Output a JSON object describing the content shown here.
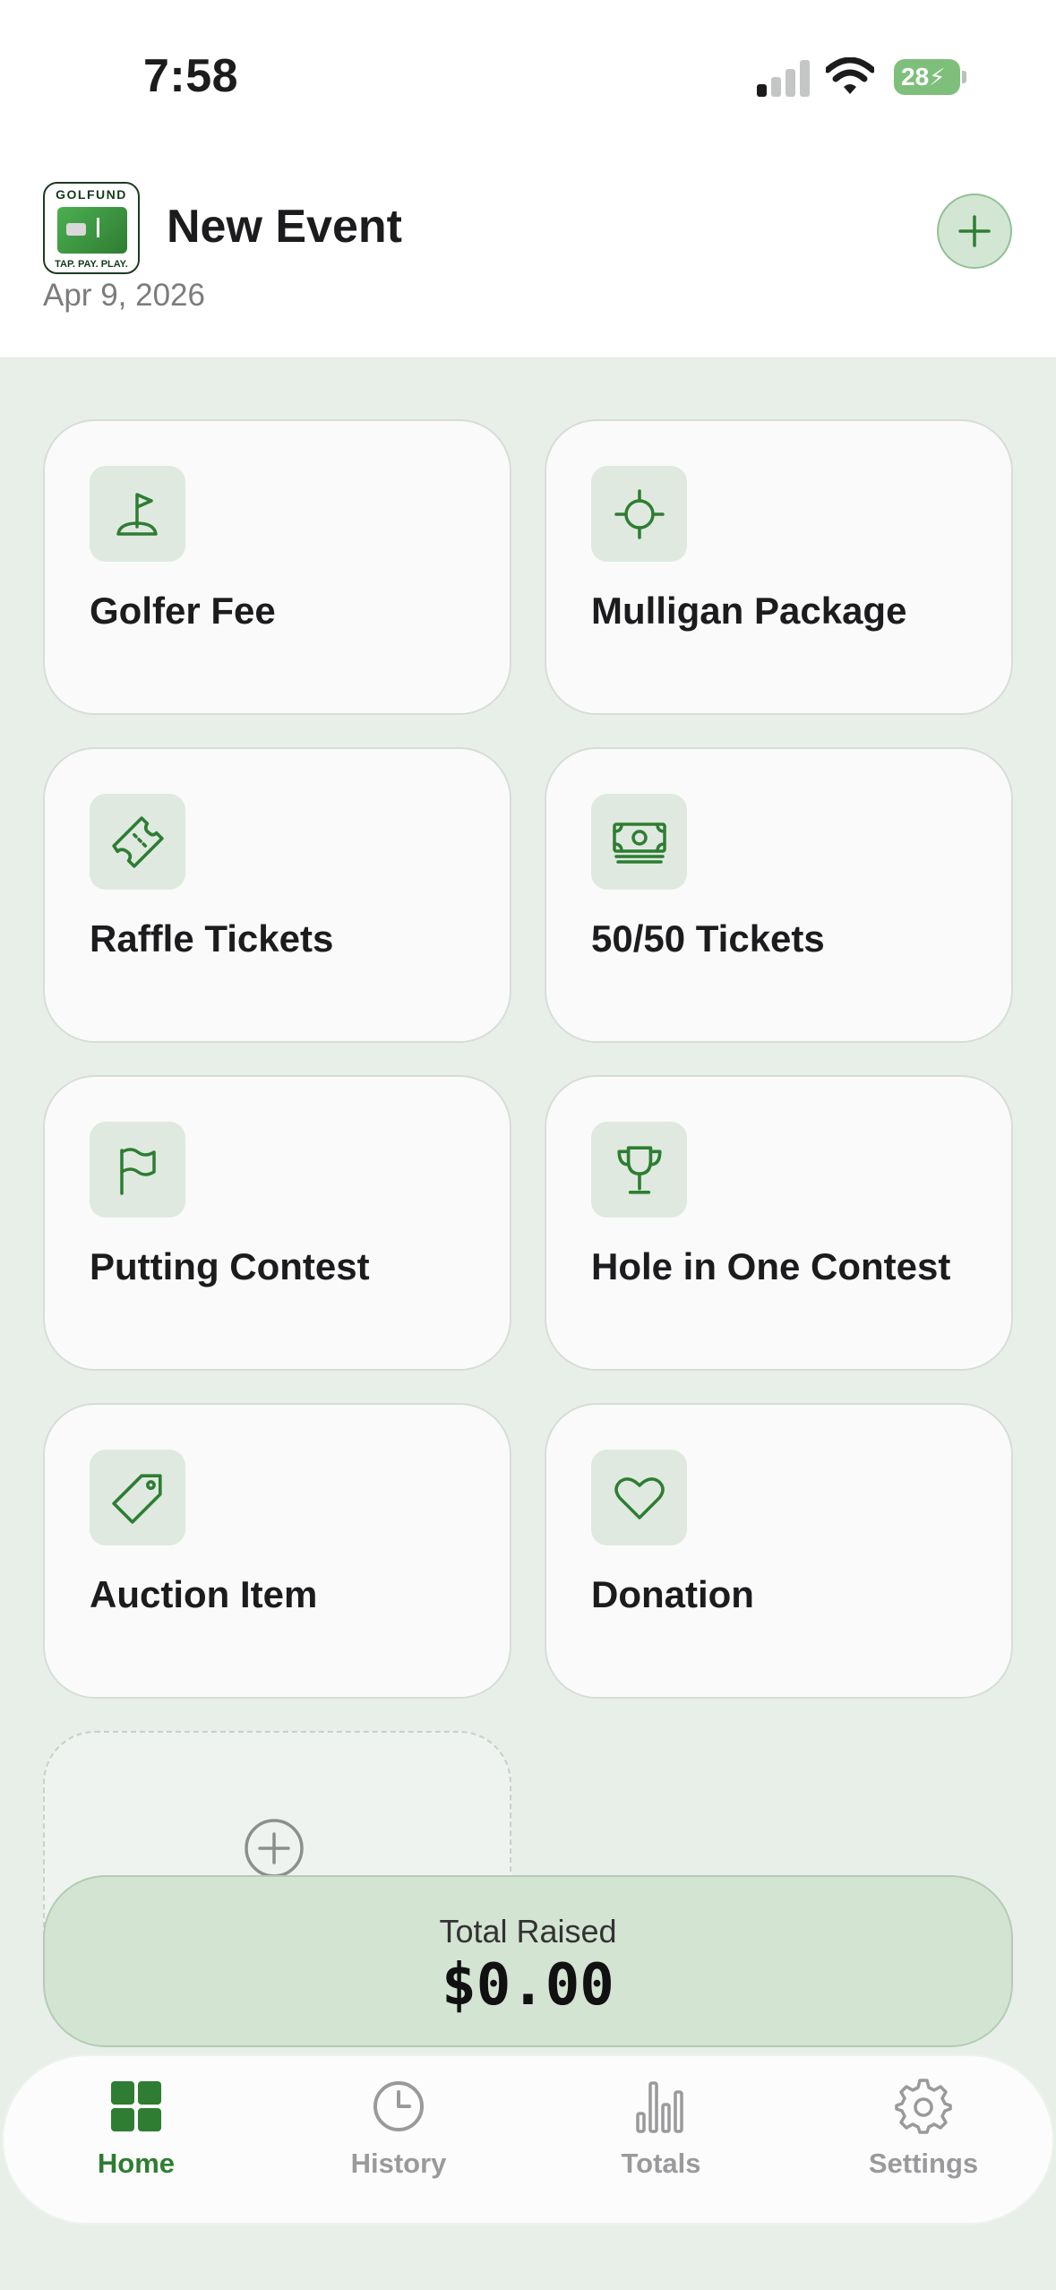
{
  "status_bar": {
    "time": "7:58",
    "battery": "28"
  },
  "header": {
    "logo_top": "GOLFUND",
    "logo_bottom": "TAP. PAY. PLAY.",
    "title": "New Event",
    "date": "Apr 9, 2026"
  },
  "tiles": [
    {
      "label": "Golfer Fee",
      "icon": "golf-flag-icon"
    },
    {
      "label": "Mulligan Package",
      "icon": "crosshair-icon"
    },
    {
      "label": "Raffle Tickets",
      "icon": "ticket-icon"
    },
    {
      "label": "50/50 Tickets",
      "icon": "cash-icon"
    },
    {
      "label": "Putting Contest",
      "icon": "flag-icon"
    },
    {
      "label": "Hole in One Contest",
      "icon": "trophy-icon"
    },
    {
      "label": "Auction Item",
      "icon": "tag-icon"
    },
    {
      "label": "Donation",
      "icon": "heart-icon"
    }
  ],
  "total": {
    "label": "Total Raised",
    "value": "$0.00"
  },
  "tabs": [
    {
      "label": "Home",
      "icon": "grid-icon",
      "active": true
    },
    {
      "label": "History",
      "icon": "clock-icon",
      "active": false
    },
    {
      "label": "Totals",
      "icon": "bar-chart-icon",
      "active": false
    },
    {
      "label": "Settings",
      "icon": "gear-icon",
      "active": false
    }
  ],
  "colors": {
    "accent": "#2e7d32",
    "background": "#e8efe9",
    "inactive": "#9a9a9c"
  }
}
